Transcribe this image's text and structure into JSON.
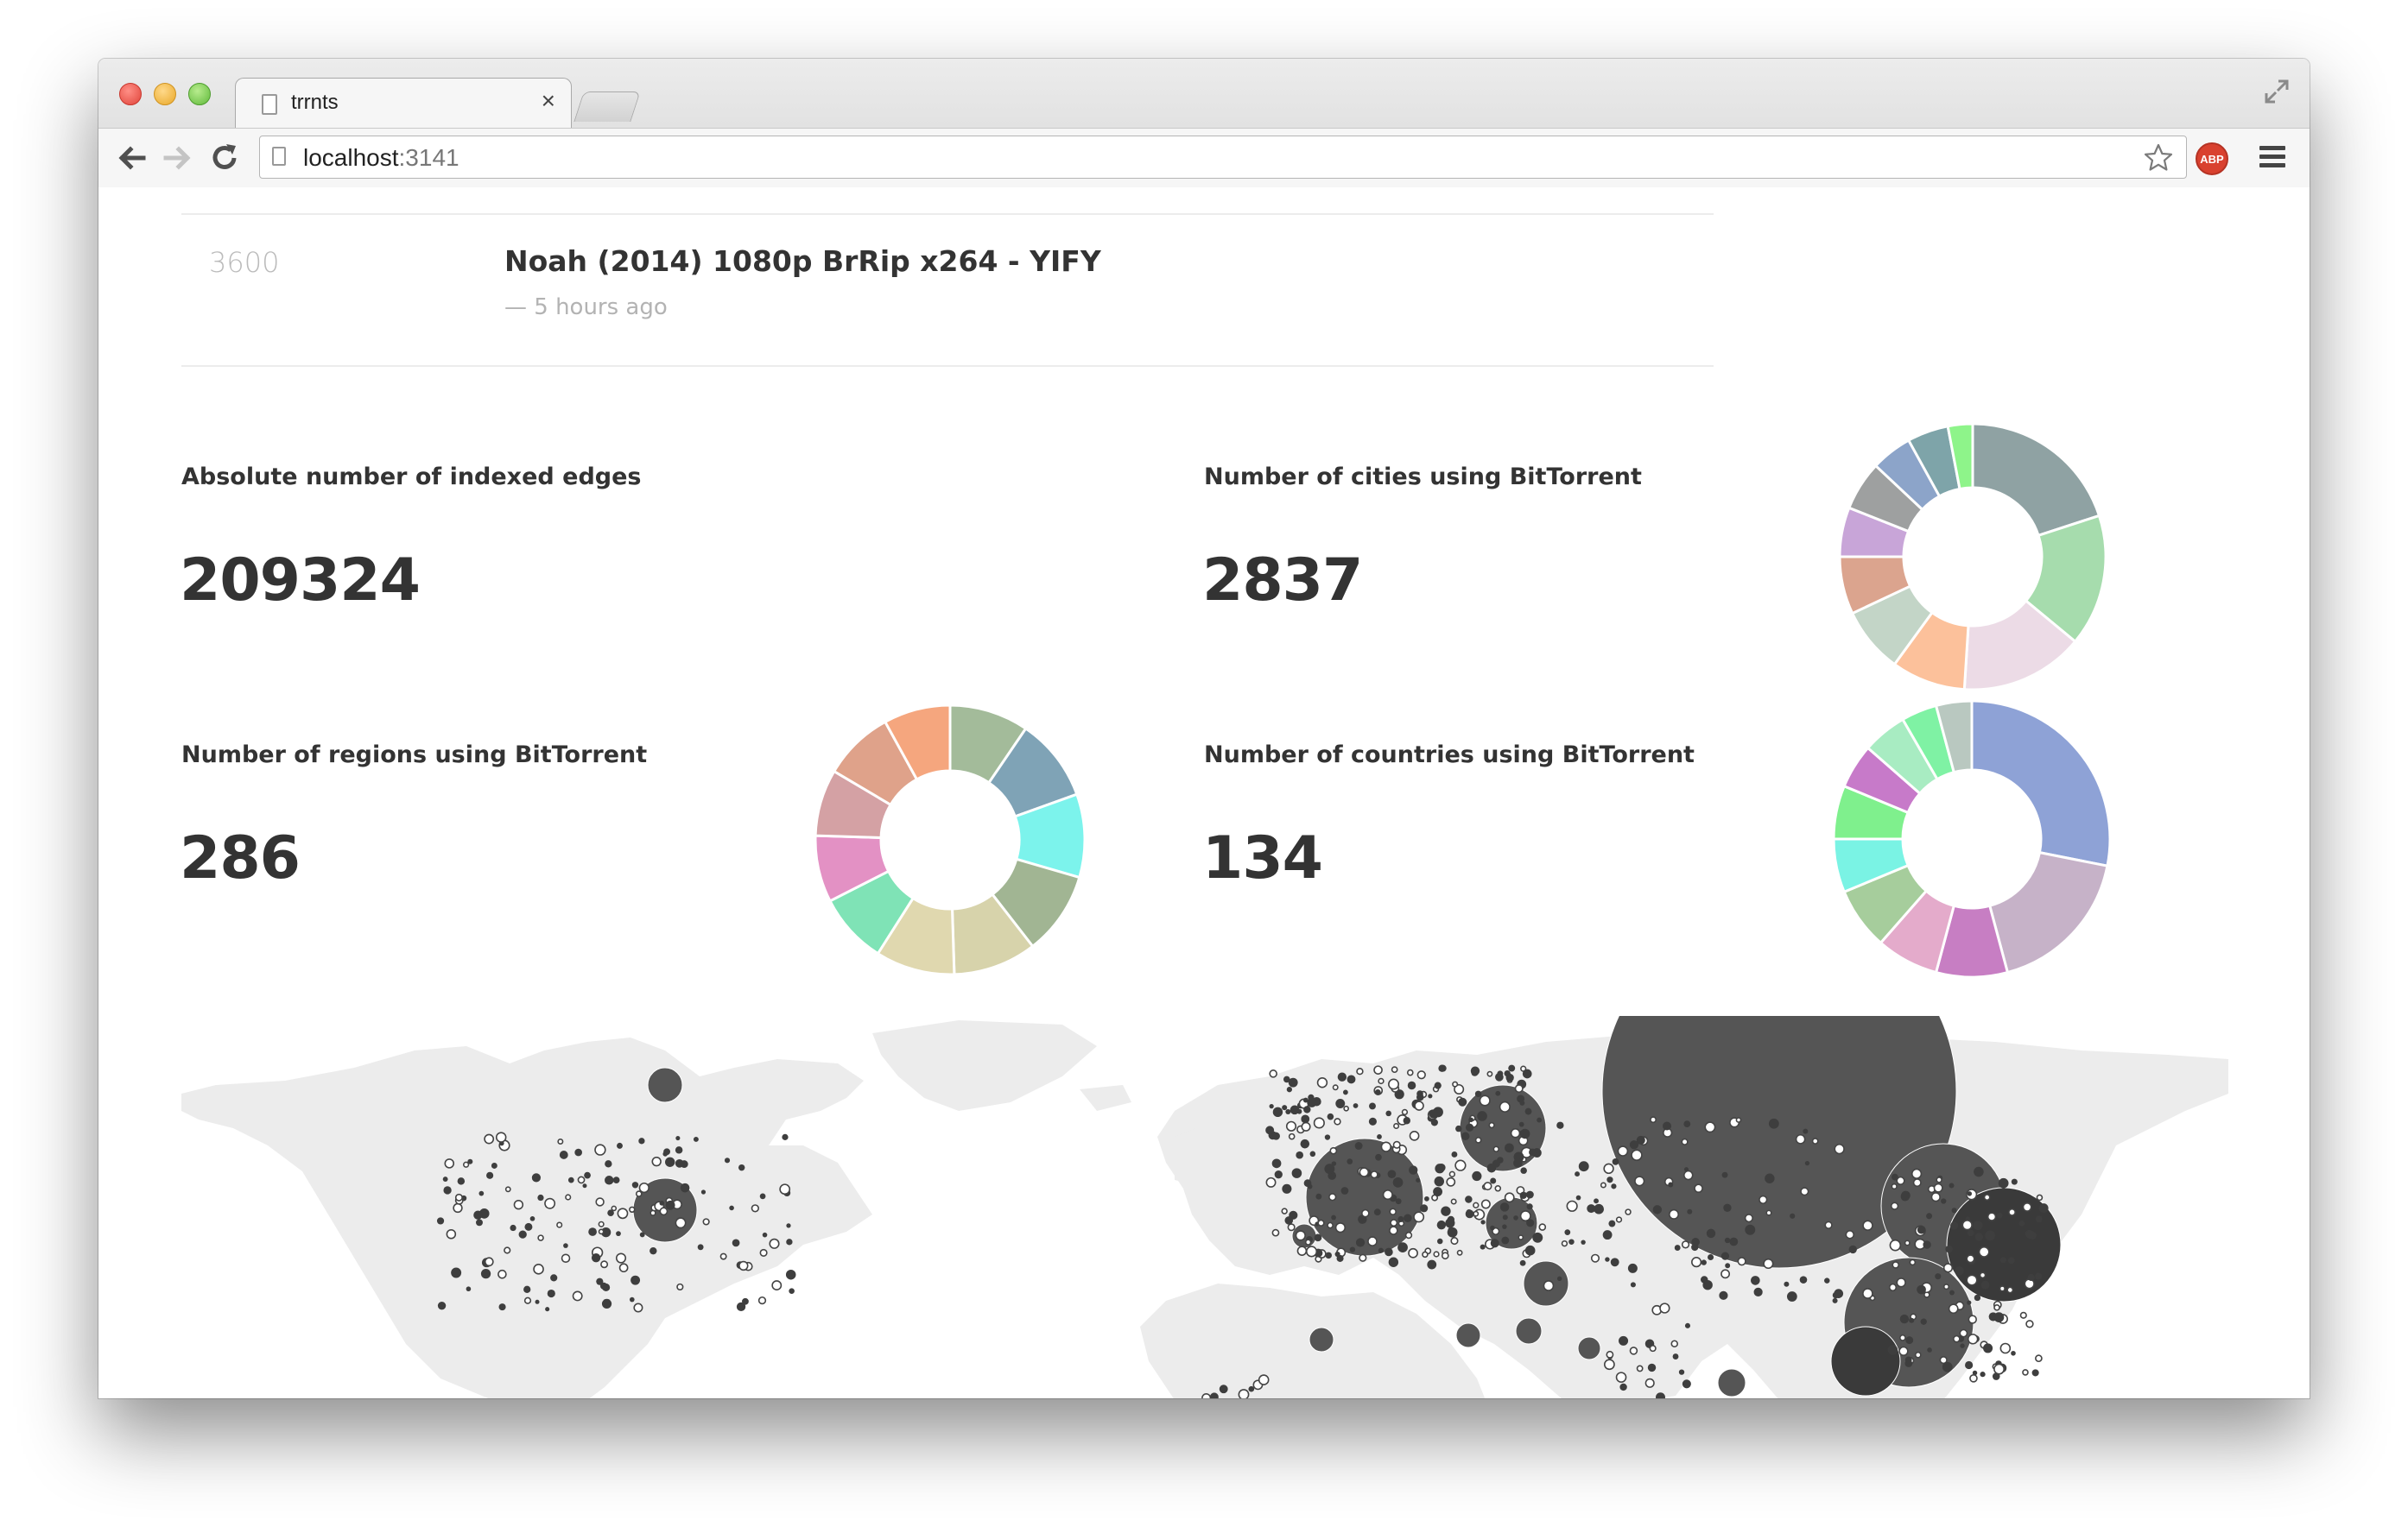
{
  "browser": {
    "tab_title": "trrnts",
    "tab_close": "×",
    "url_host": "localhost",
    "url_port": ":3141",
    "extension_label": "ABP",
    "icons": [
      "back-arrow-icon",
      "forward-arrow-icon",
      "reload-icon",
      "page-icon",
      "star-icon",
      "adblock-icon",
      "menu-icon",
      "expand-icon"
    ]
  },
  "torrent": {
    "count": "3600",
    "title": "Noah (2014) 1080p BrRip x264 - YIFY",
    "time": "— 5 hours ago"
  },
  "stats": {
    "edges": {
      "label": "Absolute number of indexed edges",
      "value": "209324"
    },
    "cities": {
      "label": "Number of cities using BitTorrent",
      "value": "2837"
    },
    "regions": {
      "label": "Number of regions using BitTorrent",
      "value": "286"
    },
    "countries": {
      "label": "Number of countries using BitTorrent",
      "value": "134"
    }
  },
  "chart_data": [
    {
      "type": "pie",
      "name": "regions-donut",
      "values": [
        9.5,
        10,
        10,
        10,
        10,
        9.5,
        8.5,
        8,
        8,
        8.5,
        8
      ],
      "colors": [
        "#a3bb9a",
        "#7fa3b6",
        "#7cf3ec",
        "#a1b593",
        "#d7d3ab",
        "#e0d8af",
        "#7fe3b6",
        "#e391c4",
        "#d4a1a4",
        "#dfa28a",
        "#f5a67e"
      ]
    },
    {
      "type": "pie",
      "name": "cities-donut",
      "values": [
        20,
        16,
        15,
        9,
        8,
        7,
        6,
        6,
        5,
        5,
        3
      ],
      "colors": [
        "#8fa2a3",
        "#a6dcad",
        "#ecdbe6",
        "#fcc19b",
        "#c3d5c7",
        "#dba48e",
        "#c8a5d8",
        "#9ea0a0",
        "#8ca4c9",
        "#7ea4a9",
        "#8ef48a"
      ]
    },
    {
      "type": "pie",
      "name": "countries-donut",
      "values": [
        27,
        17,
        8,
        7,
        7,
        6,
        6,
        5,
        5,
        4,
        4
      ],
      "colors": [
        "#8ea2d6",
        "#c6b2c8",
        "#c77ec3",
        "#e4abcb",
        "#a6cd9c",
        "#7af3e4",
        "#7ff08d",
        "#c77ac9",
        "#a8ecc2",
        "#7ff2a4",
        "#b9c8c0"
      ]
    }
  ],
  "map_colors": {
    "land": "#ececec",
    "bubble": "#555555",
    "bubble_dark": "#3a3a3a"
  }
}
